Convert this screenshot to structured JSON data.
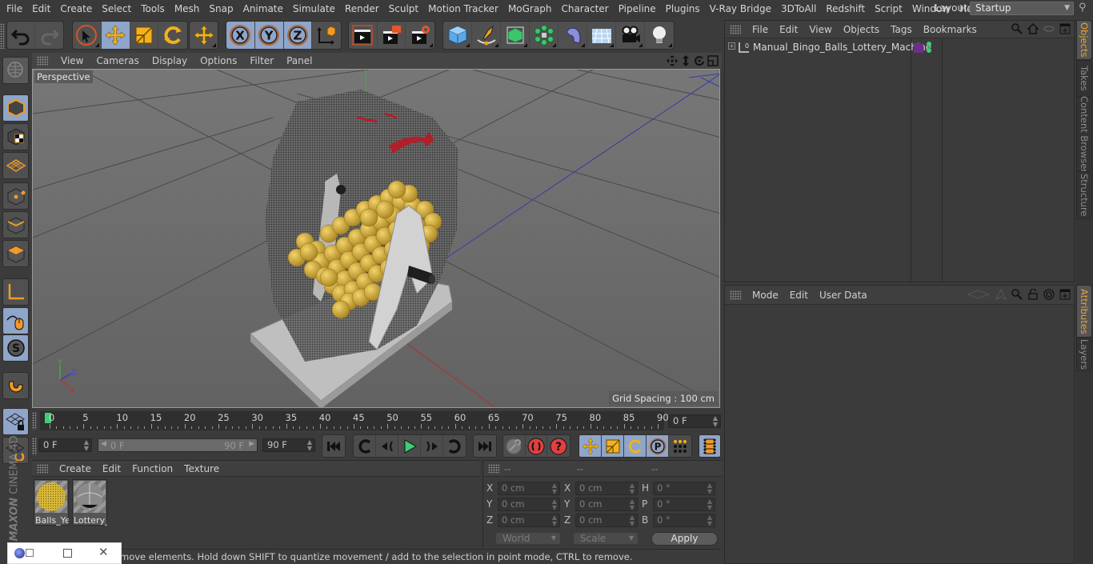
{
  "menubar": {
    "items": [
      "File",
      "Edit",
      "Create",
      "Select",
      "Tools",
      "Mesh",
      "Snap",
      "Animate",
      "Simulate",
      "Render",
      "Sculpt",
      "Motion Tracker",
      "MoGraph",
      "Character",
      "Pipeline",
      "Plugins",
      "V-Ray Bridge",
      "3DToAll",
      "Redshift",
      "Script",
      "Window",
      "Help"
    ],
    "layout_label": "Layout:",
    "layout_value": "Startup"
  },
  "toolbar": {
    "history": [
      "undo-icon",
      "redo-icon"
    ],
    "tools": [
      "live-selection-icon",
      "move-icon",
      "scale-icon",
      "rotate-icon"
    ],
    "recent_tool": "move-icon",
    "axes": [
      "X",
      "Y",
      "Z"
    ],
    "coord_system": "world-coordinates-icon",
    "render": [
      "render-view-icon",
      "render-to-picture-viewer-icon",
      "render-settings-icon"
    ],
    "objects": [
      "cube-icon",
      "pen-icon",
      "subdivision-surface-icon",
      "cloner-icon",
      "bend-deformer-icon",
      "floor-icon",
      "camera-icon",
      "light-icon"
    ]
  },
  "left_toolbar": [
    "make-editable-icon",
    "model-mode-icon",
    "texture-mode-icon",
    "workplane-icon",
    "points-mode-icon",
    "edges-mode-icon",
    "polygons-mode-icon",
    "enable-axis-icon",
    "tweak-mode-icon",
    "solo-icon",
    "snap-icon",
    "workplane-lock-icon",
    "workplane-align-icon"
  ],
  "branding": {
    "maxon": "MAXON",
    "product": "CINEMA 4D"
  },
  "viewport": {
    "menu": [
      "View",
      "Cameras",
      "Display",
      "Options",
      "Filter",
      "Panel"
    ],
    "camera_label": "Perspective",
    "grid_spacing": "Grid Spacing : 100 cm",
    "nav_icons": [
      "move-view-icon",
      "zoom-view-icon",
      "rotate-view-icon",
      "maximize-view-icon"
    ],
    "axis": {
      "x": "X",
      "y": "Y",
      "z": "Z"
    }
  },
  "timeline": {
    "ticks": [
      "0",
      "5",
      "10",
      "15",
      "20",
      "25",
      "30",
      "35",
      "40",
      "45",
      "50",
      "55",
      "60",
      "65",
      "70",
      "75",
      "80",
      "85",
      "90"
    ],
    "current_frame": "0 F",
    "start_field": "0 F",
    "range_start": "0 F",
    "range_end": "90 F",
    "end_field": "90 F",
    "playhead_frame": 0,
    "max_frame": 90
  },
  "transport": {
    "buttons": [
      "go-to-start-icon",
      "previous-key-icon",
      "previous-frame-icon",
      "play-icon",
      "next-frame-icon",
      "next-key-icon",
      "go-to-end-icon"
    ],
    "record": [
      "motion-system-icon",
      "record-active-objects-icon",
      "autokeying-icon"
    ],
    "key_tracks": [
      "move-key-icon",
      "scale-key-icon",
      "rotation-key-icon",
      "param-key-icon",
      "point-level-icon"
    ],
    "timeline_icon": "timeline-window-icon"
  },
  "material_manager": {
    "menu": [
      "Create",
      "Edit",
      "Function",
      "Texture"
    ],
    "materials": [
      {
        "name": "Balls_Yel",
        "color": "#d4b23a"
      },
      {
        "name": "Lottery_",
        "color": "#9a9a9a"
      }
    ]
  },
  "coordinates": {
    "headers": [
      "--",
      "--",
      "--"
    ],
    "rows": [
      {
        "l1": "X",
        "v1": "0 cm",
        "l2": "X",
        "v2": "0 cm",
        "l3": "H",
        "v3": "0 °"
      },
      {
        "l1": "Y",
        "v1": "0 cm",
        "l2": "Y",
        "v2": "0 cm",
        "l3": "P",
        "v3": "0 °"
      },
      {
        "l1": "Z",
        "v1": "0 cm",
        "l2": "Z",
        "v2": "0 cm",
        "l3": "B",
        "v3": "0 °"
      }
    ],
    "space": "World",
    "mode": "Scale",
    "apply": "Apply"
  },
  "status": "move elements. Hold down SHIFT to quantize movement / add to the selection in point mode, CTRL to remove.",
  "object_manager": {
    "menu": [
      "File",
      "Edit",
      "View",
      "Objects",
      "Tags",
      "Bookmarks"
    ],
    "objects": [
      {
        "name": "Manual_Bingo_Balls_Lottery_Machine",
        "layer_color": "#6a2f8a"
      }
    ]
  },
  "attribute_manager": {
    "menu": [
      "Mode",
      "Edit",
      "User Data"
    ]
  },
  "side_tabs": {
    "top": [
      "Objects",
      "Takes",
      "Content Browser",
      "Structure"
    ],
    "bottom": [
      "Attributes",
      "Layers"
    ]
  },
  "colors": {
    "accent_orange": "#e8a530",
    "active_blue": "#8fa5c9",
    "playhead_green": "#3ecf74"
  }
}
